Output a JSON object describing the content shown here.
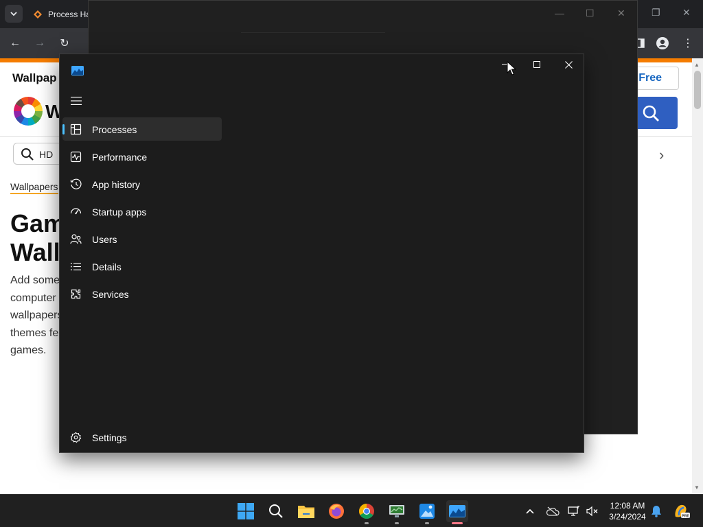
{
  "browser": {
    "tab_title": "Process Ha",
    "site_name": "Wallpap",
    "logo_letter": "W",
    "search_text": "HD",
    "breadcrumb": "Wallpapers",
    "heading_line1": "Gam",
    "heading_line2": "Wall",
    "desc_lines": [
      "Add some",
      "computer",
      "wallpapers",
      "themes fe",
      "games."
    ],
    "join_label": "n Free"
  },
  "task_manager": {
    "nav_items": [
      {
        "label": "Processes",
        "icon": "processes-icon",
        "active": true
      },
      {
        "label": "Performance",
        "icon": "performance-icon",
        "active": false
      },
      {
        "label": "App history",
        "icon": "app-history-icon",
        "active": false
      },
      {
        "label": "Startup apps",
        "icon": "startup-apps-icon",
        "active": false
      },
      {
        "label": "Users",
        "icon": "users-icon",
        "active": false
      },
      {
        "label": "Details",
        "icon": "details-icon",
        "active": false
      },
      {
        "label": "Services",
        "icon": "services-icon",
        "active": false
      }
    ],
    "settings_label": "Settings",
    "accent_color": "#4cc2ff"
  },
  "taskbar": {
    "apps": [
      "windows-start",
      "search",
      "file-explorer",
      "firefox",
      "chrome",
      "monitor-app",
      "photos-app",
      "task-manager"
    ],
    "time": "12:08 AM",
    "date": "3/24/2024"
  }
}
